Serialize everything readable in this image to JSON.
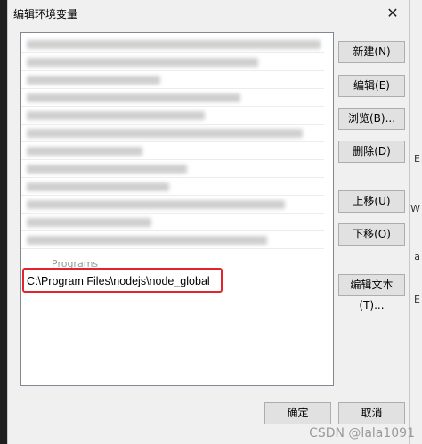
{
  "window": {
    "title": "编辑环境变量"
  },
  "list": {
    "partial_text": "Programs",
    "selected_path": "C:\\Program Files\\nodejs\\node_global"
  },
  "buttons": {
    "new": {
      "label": "新建(N)"
    },
    "edit": {
      "label": "编辑(E)"
    },
    "browse": {
      "label": "浏览(B)..."
    },
    "delete": {
      "label": "删除(D)"
    },
    "move_up": {
      "label": "上移(U)"
    },
    "move_down": {
      "label": "下移(O)"
    },
    "edit_text": {
      "label": "编辑文本(T)..."
    },
    "ok": {
      "label": "确定"
    },
    "cancel": {
      "label": "取消"
    }
  },
  "watermark": "CSDN @lala1091",
  "background_fragments": [
    "E",
    "W",
    "a",
    "E"
  ],
  "colors": {
    "highlight": "#e0262c"
  }
}
